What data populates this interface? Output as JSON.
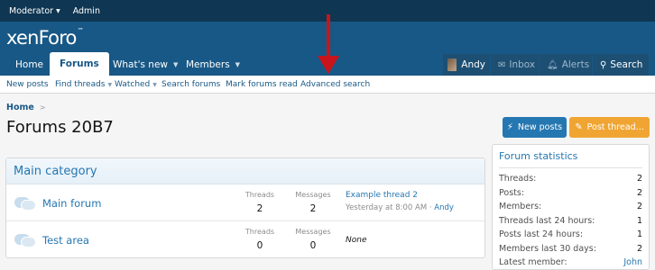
{
  "staffbar": {
    "moderator": "Moderator",
    "admin": "Admin"
  },
  "logo": {
    "text": "xenForo",
    "tm": "™"
  },
  "nav": {
    "home": "Home",
    "forums": "Forums",
    "whats_new": "What's new",
    "members": "Members",
    "user": "Andy",
    "inbox": "Inbox",
    "alerts": "Alerts",
    "search": "Search"
  },
  "subnav": {
    "new_posts": "New posts",
    "find_threads": "Find threads",
    "watched": "Watched",
    "search_forums": "Search forums",
    "mark_read": "Mark forums read",
    "advanced_search": "Advanced search"
  },
  "breadcrumb": {
    "home": "Home",
    "sep": ">"
  },
  "page": {
    "title": "Forums 20B7"
  },
  "buttons": {
    "new_posts": "New posts",
    "post_thread": "Post thread..."
  },
  "category": {
    "title": "Main category",
    "nodes": [
      {
        "title": "Main forum",
        "threads_label": "Threads",
        "threads": "2",
        "messages_label": "Messages",
        "messages": "2",
        "latest_title": "Example thread 2",
        "latest_meta": "Yesterday at 8:00 AM · ",
        "latest_user": "Andy"
      },
      {
        "title": "Test area",
        "threads_label": "Threads",
        "threads": "0",
        "messages_label": "Messages",
        "messages": "0",
        "latest_none": "None"
      }
    ]
  },
  "stats": {
    "title": "Forum statistics",
    "rows": [
      {
        "label": "Threads:",
        "value": "2"
      },
      {
        "label": "Posts:",
        "value": "2"
      },
      {
        "label": "Members:",
        "value": "2"
      },
      {
        "label": "Threads last 24 hours:",
        "value": "1"
      },
      {
        "label": "Posts last 24 hours:",
        "value": "1"
      },
      {
        "label": "Members last 30 days:",
        "value": "2"
      },
      {
        "label": "Latest member:",
        "value": "John"
      }
    ]
  },
  "colors": {
    "header": "#185886",
    "staffbar": "#0f3652",
    "accent": "#2577b1",
    "post_button": "#f0a533",
    "annotation_arrow": "#c8151b"
  }
}
